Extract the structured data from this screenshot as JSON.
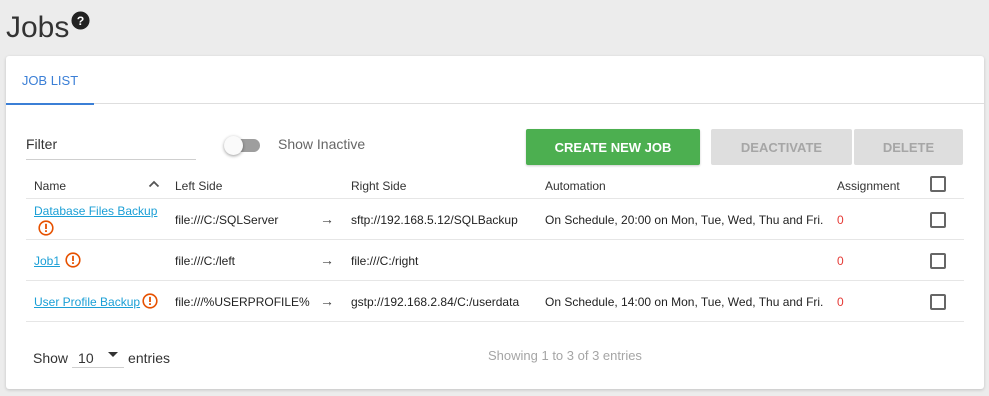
{
  "page": {
    "title": "Jobs",
    "help_icon": "help-circle-icon"
  },
  "tabs": [
    {
      "label": "JOB LIST",
      "active": true
    }
  ],
  "toolbar": {
    "filter_label": "Filter",
    "filter_value": "",
    "show_inactive_label": "Show Inactive",
    "show_inactive": false,
    "create_label": "CREATE NEW JOB",
    "deactivate_label": "DEACTIVATE",
    "delete_label": "DELETE"
  },
  "table": {
    "columns": [
      "Name",
      "Left Side",
      "Right Side",
      "Automation",
      "Assignment"
    ],
    "rows": [
      {
        "name": "Database Files Backup",
        "left": "file:///C:/SQLServer",
        "arrow": "→",
        "right": "sftp://192.168.5.12/SQLBackup",
        "automation": "On Schedule, 20:00 on Mon, Tue, Wed, Thu and Fri.",
        "assignment": "0"
      },
      {
        "name": "Job1",
        "left": "file:///C:/left",
        "arrow": "→",
        "right": "file:///C:/right",
        "automation": "",
        "assignment": "0"
      },
      {
        "name": "User Profile Backup",
        "left": "file:///%USERPROFILE%",
        "arrow": "→",
        "right": "gstp://192.168.2.84/C:/userdata",
        "automation": "On Schedule, 14:00 on Mon, Tue, Wed, Thu and Fri.",
        "assignment": "0"
      }
    ]
  },
  "footer": {
    "show_label": "Show",
    "page_size": "10",
    "entries_label": "entries",
    "info": "Showing 1 to 3 of 3 entries"
  },
  "colors": {
    "accent": "#3b7fd6",
    "create": "#4caf50",
    "link": "#1a9fd6",
    "warning": "#e65100",
    "assignment": "#e53935"
  }
}
